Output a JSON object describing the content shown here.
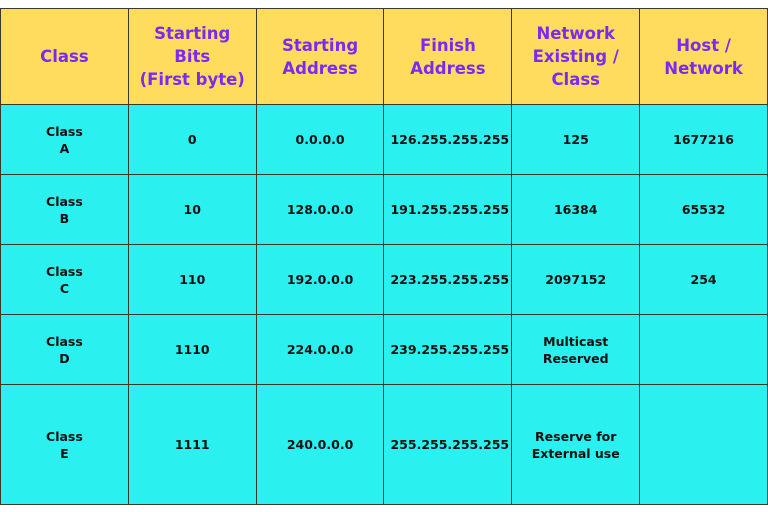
{
  "colors": {
    "header_bg": "#FFDC5E",
    "header_text": "#7A2BEF",
    "body_bg": "#2AF0F0"
  },
  "headers": [
    "Class",
    "Starting Bits\n(First byte)",
    "Starting\nAddress",
    "Finish\nAddress",
    "Network\nExisting /\nClass",
    "Host /\nNetwork"
  ],
  "rows": [
    [
      "Class\nA",
      "0",
      "0.0.0.0",
      "126.255.255.255",
      "125",
      "1677216"
    ],
    [
      "Class\nB",
      "10",
      "128.0.0.0",
      "191.255.255.255",
      "16384",
      "65532"
    ],
    [
      "Class\nC",
      "110",
      "192.0.0.0",
      "223.255.255.255",
      "2097152",
      "254"
    ],
    [
      "Class\nD",
      "1110",
      "224.0.0.0",
      "239.255.255.255",
      "Multicast\nReserved",
      ""
    ],
    [
      "Class\nE",
      "1111",
      "240.0.0.0",
      "255.255.255.255",
      "Reserve for\nExternal use",
      ""
    ]
  ]
}
